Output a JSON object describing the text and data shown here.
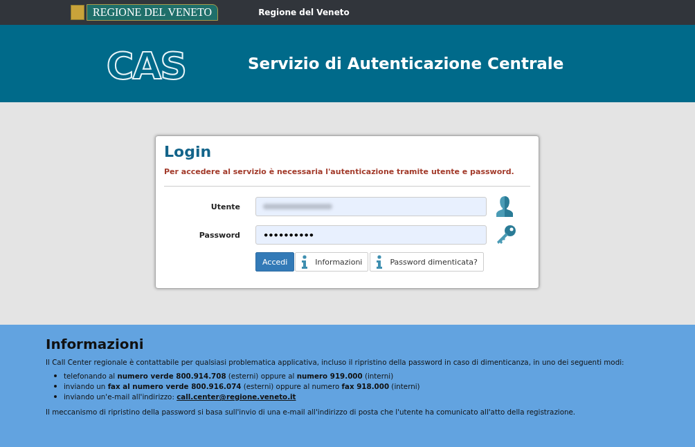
{
  "top_bar": {
    "logo_text": "REGIONE DEL VENETO",
    "title": "Regione del Veneto"
  },
  "header": {
    "logo": "CAS",
    "title": "Servizio di Autenticazione Centrale"
  },
  "login": {
    "title": "Login",
    "message": "Per accedere al servizio è necessaria l'autenticazione tramite utente e password.",
    "fields": [
      {
        "label": "Utente",
        "kind": "user",
        "blurred": true
      },
      {
        "label": "Password",
        "kind": "password",
        "value": "••••••••••",
        "blurred": false
      }
    ],
    "buttons": [
      {
        "label": "Accedi",
        "kind": "primary"
      },
      {
        "label": "Informazioni",
        "kind": "info"
      },
      {
        "label": "Password dimenticata?",
        "kind": "info"
      }
    ]
  },
  "info": {
    "title": "Informazioni",
    "intro": "Il Call Center regionale è contattabile per qualsiasi problematica applicativa, incluso il ripristino della password in caso di dimenticanza, in uno dei seguenti modi:",
    "items": [
      {
        "text": "telefonando al **numero verde 800.914.708** (esterni) oppure al **numero 919.000** (interni)"
      },
      {
        "text": "inviando un **fax al numero verde 800.916.074** (esterni) oppure al numero **fax 918.000** (interni)"
      },
      {
        "text": "inviando un'e-mail all'indirizzo:",
        "link": "call.center@regione.veneto.it"
      }
    ],
    "note": "Il meccanismo di ripristino della password si basa sull'invio di una e-mail all'indirizzo di posta che l'utente ha comunicato all'atto della registrazione."
  }
}
